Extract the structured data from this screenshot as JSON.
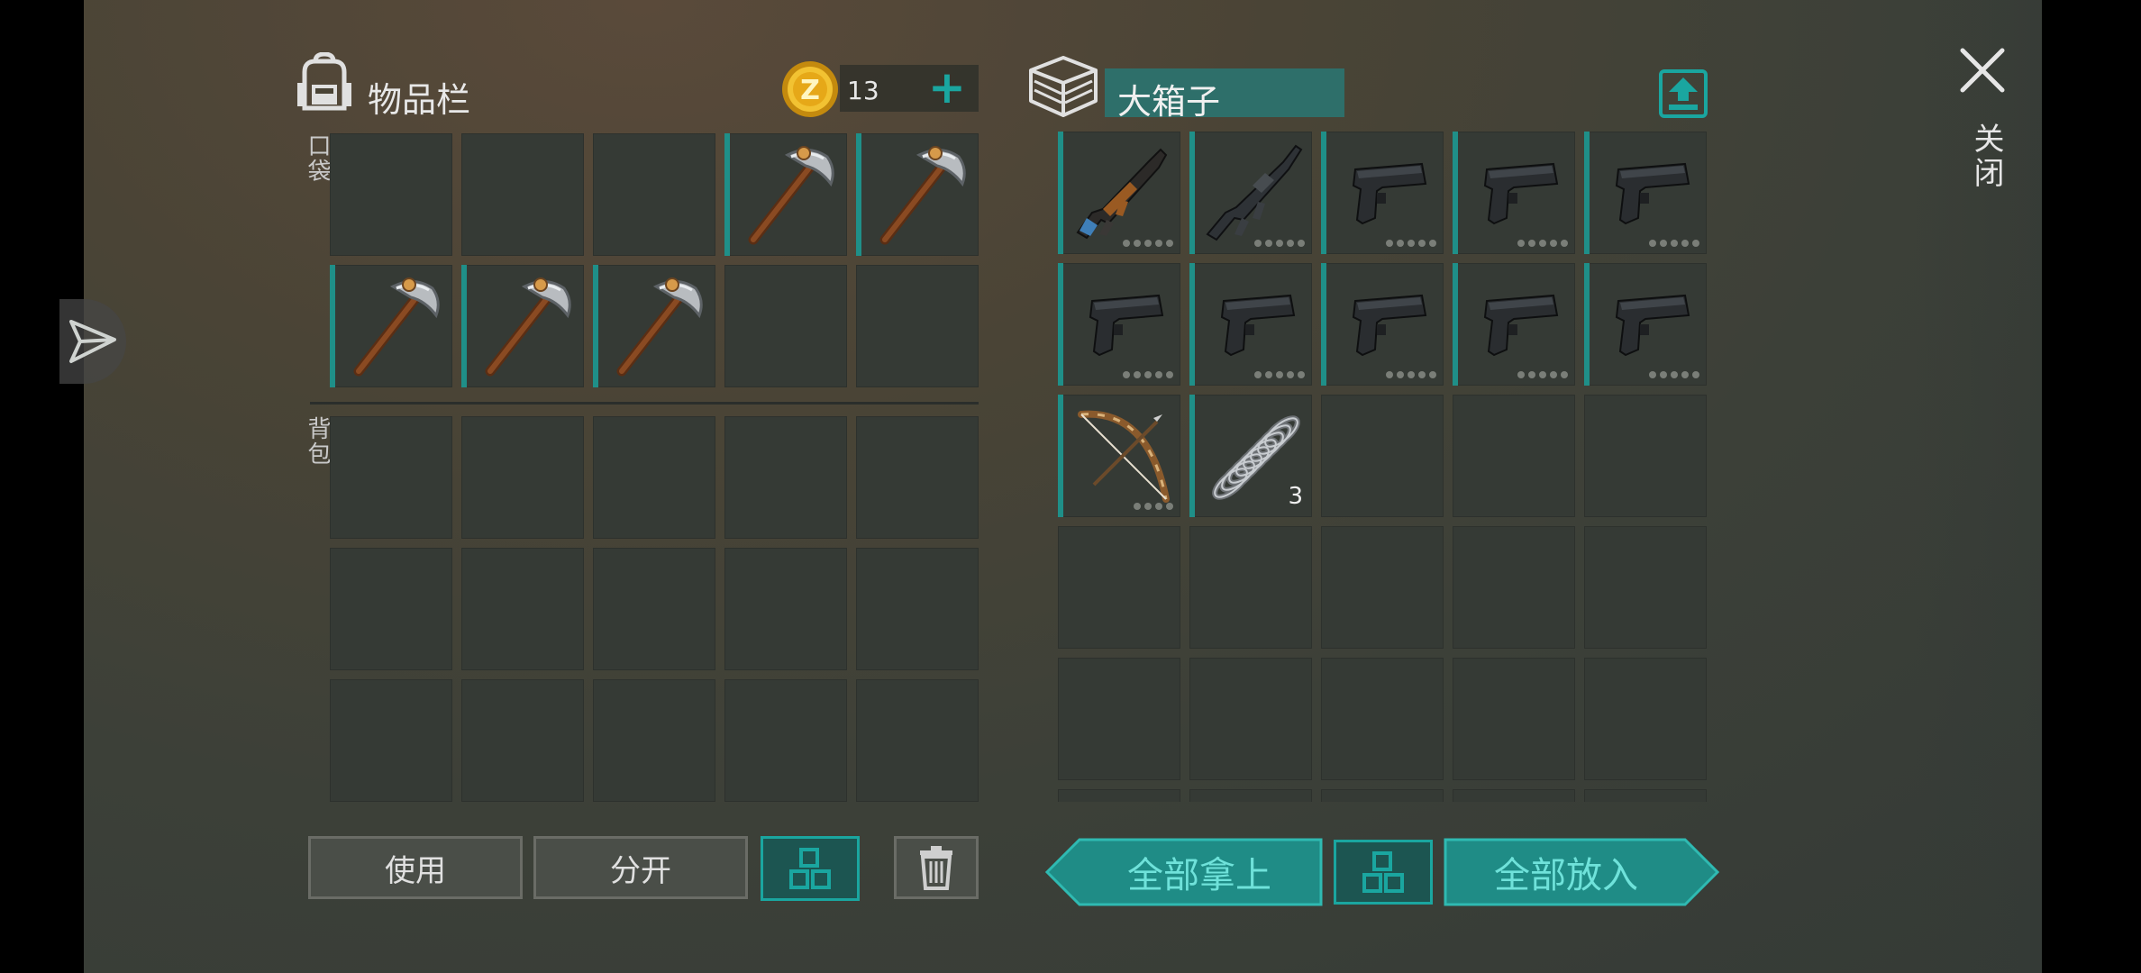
{
  "inventory": {
    "title": "物品栏",
    "pocket_label": "口袋",
    "backpack_label": "背包",
    "coins": "13",
    "add_coins": "+",
    "pocket_slots": [
      "",
      "",
      "",
      "pickaxe",
      "pickaxe",
      "pickaxe",
      "pickaxe",
      "pickaxe",
      "",
      ""
    ],
    "backpack_slots": [
      "",
      "",
      "",
      "",
      "",
      "",
      "",
      "",
      "",
      "",
      "",
      "",
      "",
      "",
      ""
    ]
  },
  "container": {
    "name": "大箱子",
    "slots": [
      {
        "item": "ak-rifle"
      },
      {
        "item": "m16-rifle"
      },
      {
        "item": "pistol"
      },
      {
        "item": "pistol"
      },
      {
        "item": "pistol"
      },
      {
        "item": "pistol"
      },
      {
        "item": "pistol"
      },
      {
        "item": "pistol"
      },
      {
        "item": "pistol"
      },
      {
        "item": "pistol"
      },
      {
        "item": "bow"
      },
      {
        "item": "spring",
        "qty": "3"
      },
      {
        "item": ""
      },
      {
        "item": ""
      },
      {
        "item": ""
      },
      {
        "item": ""
      },
      {
        "item": ""
      },
      {
        "item": ""
      },
      {
        "item": ""
      },
      {
        "item": ""
      },
      {
        "item": ""
      },
      {
        "item": ""
      },
      {
        "item": ""
      },
      {
        "item": ""
      },
      {
        "item": ""
      },
      {
        "item": ""
      },
      {
        "item": ""
      },
      {
        "item": ""
      },
      {
        "item": ""
      },
      {
        "item": ""
      }
    ]
  },
  "actions": {
    "use": "使用",
    "split": "分开",
    "take_all": "全部拿上",
    "put_all": "全部放入",
    "close": "关闭"
  },
  "colors": {
    "accent": "#1aa6a0",
    "slot": "#353a35",
    "field": "#2e6f6a"
  }
}
